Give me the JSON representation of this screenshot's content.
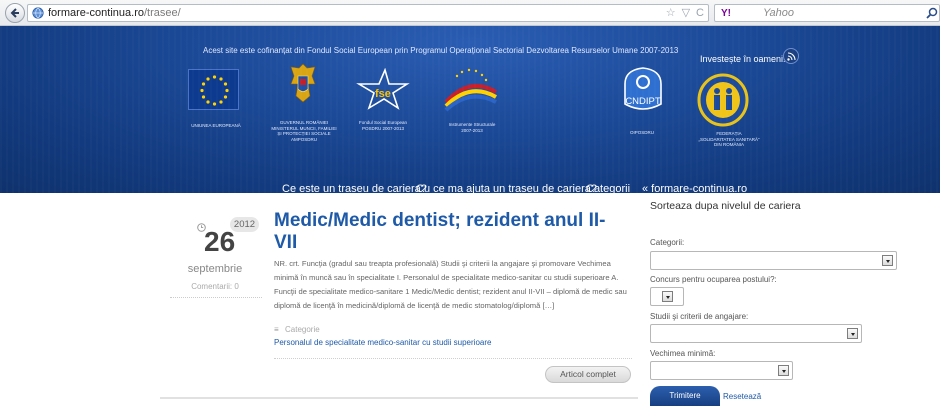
{
  "browser": {
    "url_domain": "formare-continua.ro",
    "url_path": "/trasee/",
    "star_glyph": "☆",
    "dropdown_glyph": "▽",
    "reload_glyph": "C",
    "search_engine": "Y!",
    "search_placeholder": "Yahoo"
  },
  "header": {
    "cofinance_text": "Acest site este cofinanțat din Fondul Social European prin Programul Operațional Sectorial Dezvoltarea Resurselor Umane 2007-2013",
    "slogan": "Investește în oameni!",
    "logos": [
      {
        "caption": "UNIUNEA EUROPEANĂ"
      },
      {
        "caption": "GUVERNUL ROMÂNIEI\nMINISTERUL MUNCII, FAMILIEI\nȘI PROTECȚIEI SOCIALE\nAMPOSDRU"
      },
      {
        "caption": "Fondul Social European\nPOSDRU 2007-2013",
        "mark": "fse"
      },
      {
        "caption": "Instrumente Structurale\n2007-2013"
      },
      {
        "caption": "OIPOSDRU",
        "mark": "CNDIPT"
      },
      {
        "caption": "FEDERAȚIA\n„SOLIDARITATEA SANITARĂ”\nDIN ROMÂNIA"
      }
    ],
    "nav": [
      {
        "label": "Ce este un traseu de cariera?"
      },
      {
        "label": "Cu ce ma ajuta un traseu de cariera?"
      },
      {
        "label": "Categorii"
      },
      {
        "label": "« formare-continua.ro"
      }
    ]
  },
  "article": {
    "year": "2012",
    "day": "26",
    "month": "septembrie",
    "comments": "Comentarii: 0",
    "title": "Medic/Medic dentist; rezident anul II-VII",
    "excerpt": "NR. crt. Funcţia (gradul sau treapta profesională) Studii şi criterii la angajare şi promovare Vechimea minimă în muncă sau în specialitate I. Personalul de specialitate medico-sanitar cu studii superioare A. Funcţii de specialitate medico-sanitare 1 Medic/Medic dentist; rezident anul II-VII – diplomă de medic sau diplomă de licenţă în medicină/diplomă de licenţă de medic stomatolog/diplomă […]",
    "category_label": "Categorie",
    "category_link": "Personalul de specialitate medico-sanitar cu studii superioare",
    "read_more": "Articol complet"
  },
  "sidebar": {
    "title": "Sorteaza dupa nivelul de cariera",
    "filters": [
      {
        "label": "Categorii:",
        "value": ""
      },
      {
        "label": "Concurs pentru ocuparea postului?:",
        "value": ""
      },
      {
        "label": "Studii şi criterii de angajare:",
        "value": ""
      },
      {
        "label": "Vechimea minimă:",
        "value": ""
      }
    ],
    "submit": "Trimitere",
    "reset": "Resetează"
  }
}
